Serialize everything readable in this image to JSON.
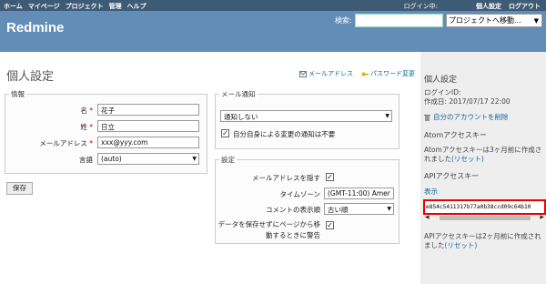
{
  "top_menu": {
    "items": [
      "ホーム",
      "マイページ",
      "プロジェクト",
      "管理",
      "ヘルプ"
    ],
    "logged_in": "ログイン中:",
    "my_account": "個人設定",
    "logout": "ログアウト"
  },
  "header": {
    "title": "Redmine",
    "search_label": "検索:",
    "search_value": "",
    "project_jump": "プロジェクトへ移動..."
  },
  "page": {
    "title": "個人設定",
    "email_link": "メールアドレス",
    "password_link": "パスワード変更"
  },
  "info": {
    "legend": "情報",
    "firstname_label": "名",
    "firstname_value": "花子",
    "lastname_label": "姓",
    "lastname_value": "日立",
    "email_label": "メールアドレス",
    "email_value": "xxx@yyy.com",
    "language_label": "言語",
    "language_value": "(auto)",
    "required_mark": "*"
  },
  "save_button": "保存",
  "mail": {
    "legend": "メール通知",
    "notify_value": "通知しない",
    "no_self_notified": "自分自身による変更の通知は不要"
  },
  "prefs": {
    "legend": "設定",
    "hide_mail_label": "メールアドレスを隠す",
    "timezone_label": "タイムゾーン",
    "timezone_value": "(GMT-11:00) Amer",
    "comments_label": "コメントの表示順",
    "comments_value": "古い順",
    "warn_label_1": "データを保存せずにページから移",
    "warn_label_2": "動するときに警告"
  },
  "sidebar": {
    "title": "個人設定",
    "login_label": "ログインID:",
    "created": "作成日: 2017/07/17 22:00",
    "delete_link": "自分のアカウントを削除",
    "atom_title": "Atomアクセスキー",
    "atom_text": "Atomアクセスキーは3ヶ月前に作成されました",
    "reset": "(リセット)",
    "api_title": "APIアクセスキー",
    "show": "表示",
    "api_key": "e854c5411317b77a0b38ccd09c64b10",
    "api_text": "APIアクセスキーは2ヶ月前に作成されました"
  },
  "colors": {
    "top_menu": "#3e5b76",
    "header": "#628db6",
    "link": "#116699",
    "required": "#cc0000",
    "highlight": "#ee0000"
  }
}
